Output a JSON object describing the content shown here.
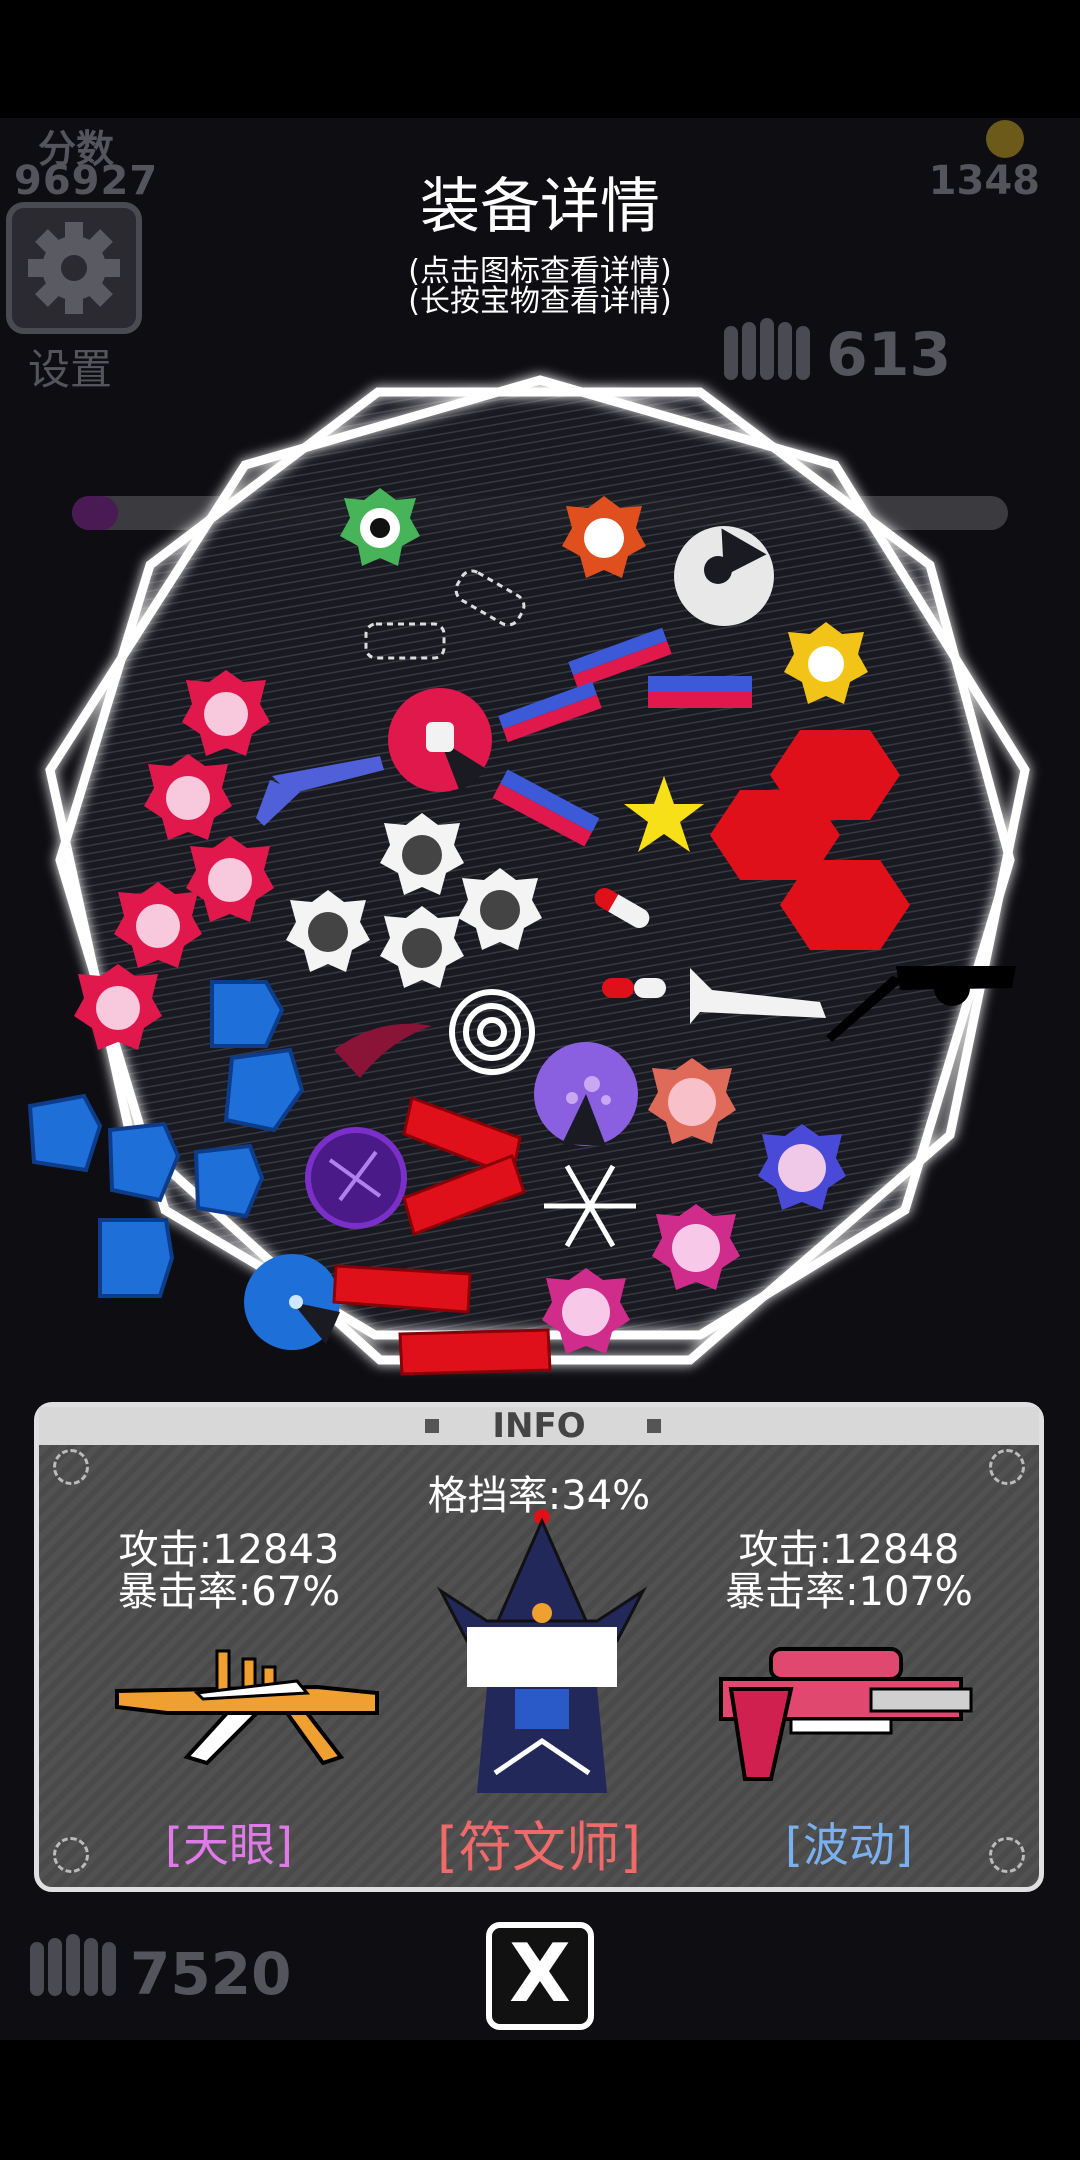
{
  "hud": {
    "score_label": "分数",
    "score_value": "96927",
    "gold_value": "1348",
    "settings_label": "设置",
    "ammo_value": "613",
    "bottom_left_value": "7520"
  },
  "dialog": {
    "title": "装备详情",
    "hint_tap": "(点击图标查看详情)",
    "hint_hold": "(长按宝物查看详情)"
  },
  "info_panel": {
    "header": "INFO",
    "block_rate": "格挡率:34%",
    "left_weapon": {
      "attack": "攻击:12843",
      "crit": "暴击率:67%",
      "name": "[天眼]",
      "name_color": "#e07ae8"
    },
    "character": {
      "name": "[符文师]",
      "name_color": "#f06a6a"
    },
    "right_weapon": {
      "attack": "攻击:12848",
      "crit": "暴击率:107%",
      "name": "[波动]",
      "name_color": "#7ab0f0"
    }
  },
  "close_button": {
    "label": "X"
  },
  "colors": {
    "background": "#0d0d12",
    "frame": "#ffffff",
    "red_item": "#e0101a",
    "blue_item": "#1e6fd8",
    "pink_gear": "#e0184c",
    "panel": "#4d4d4d"
  }
}
